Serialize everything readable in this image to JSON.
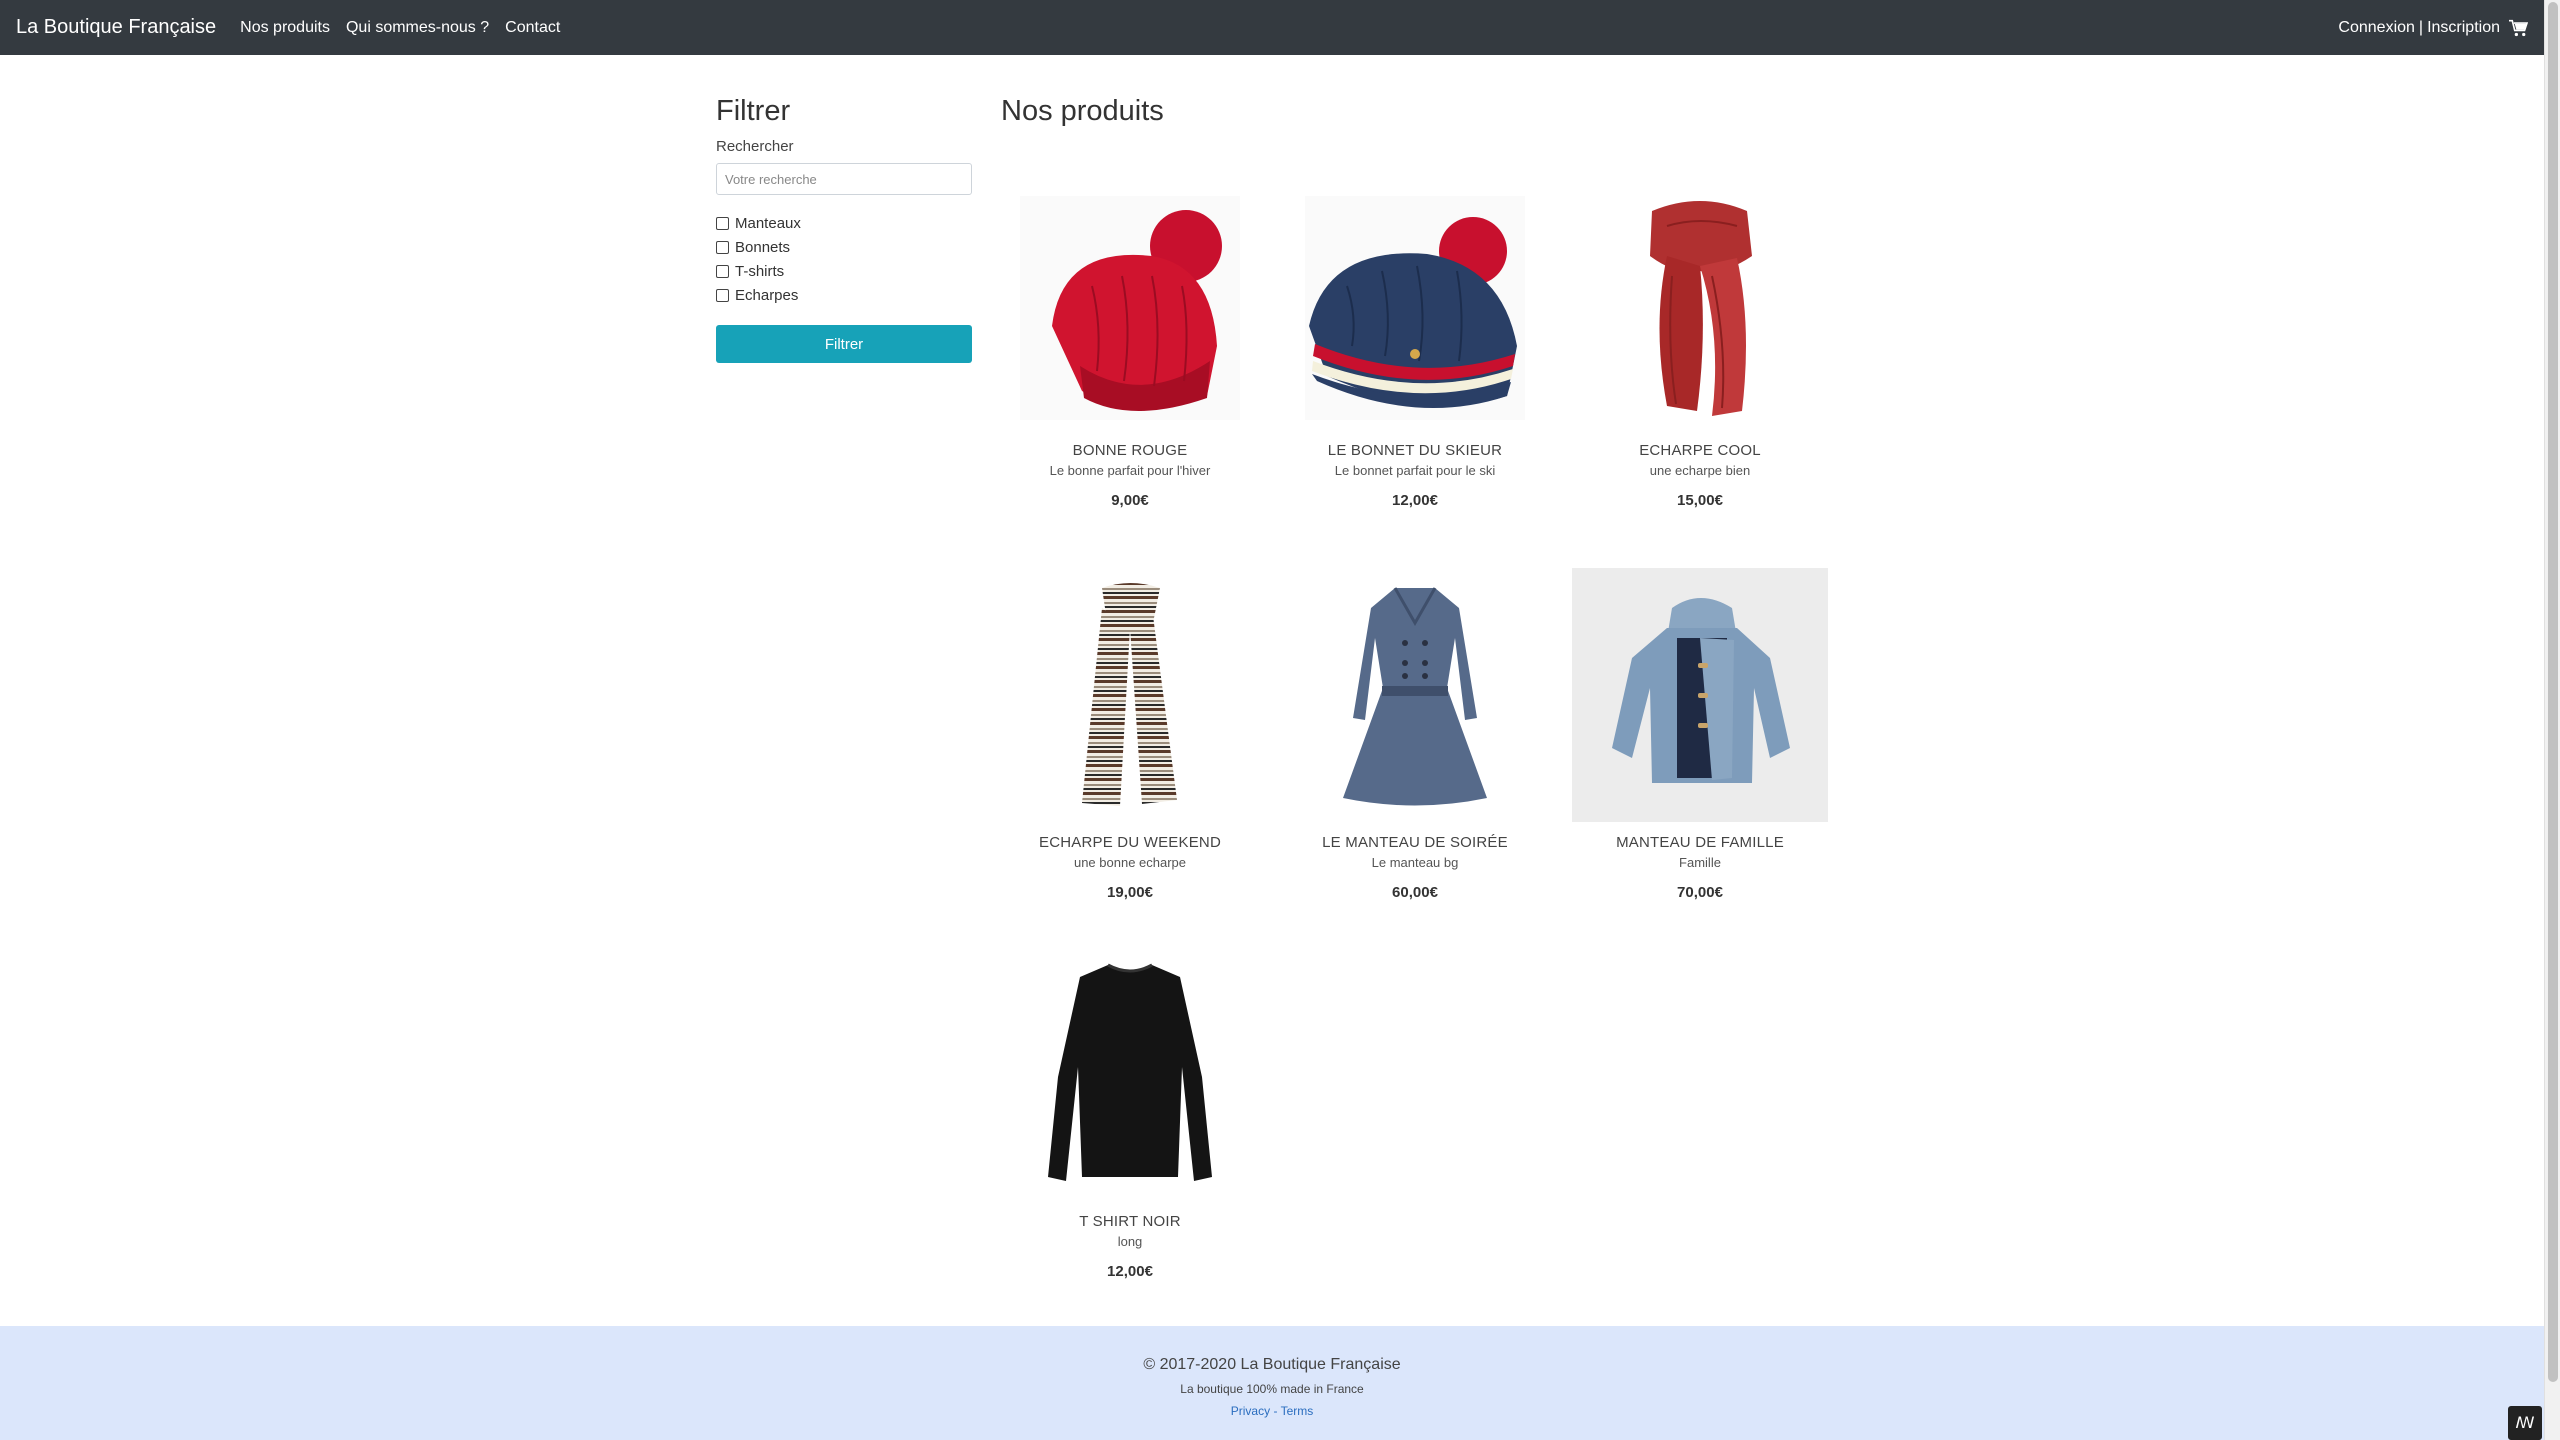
{
  "navbar": {
    "brand": "La Boutique Française",
    "links": [
      "Nos produits",
      "Qui sommes-nous ?",
      "Contact"
    ],
    "login": "Connexion",
    "separator": "|",
    "register": "Inscription",
    "cart_icon": "shopping-cart-icon"
  },
  "filter": {
    "title": "Filtrer",
    "search_label": "Rechercher",
    "search_placeholder": "Votre recherche",
    "categories": [
      "Manteaux",
      "Bonnets",
      "T-shirts",
      "Echarpes"
    ],
    "button_label": "Filtrer",
    "button_color": "#17a2b8"
  },
  "main": {
    "title": "Nos produits",
    "products": [
      {
        "name": "BONNE ROUGE",
        "desc": "Le bonne parfait pour l'hiver",
        "price": "9,00€",
        "icon": "red-beanie-image"
      },
      {
        "name": "LE BONNET DU SKIEUR",
        "desc": "Le bonnet parfait pour le ski",
        "price": "12,00€",
        "icon": "ski-beanie-image"
      },
      {
        "name": "ECHARPE COOL",
        "desc": "une echarpe bien",
        "price": "15,00€",
        "icon": "red-scarf-image"
      },
      {
        "name": "ECHARPE DU WEEKEND",
        "desc": "une bonne echarpe",
        "price": "19,00€",
        "icon": "striped-scarf-image"
      },
      {
        "name": "LE MANTEAU DE SOIRÉE",
        "desc": "Le manteau bg",
        "price": "60,00€",
        "icon": "evening-coat-image"
      },
      {
        "name": "MANTEAU DE FAMILLE",
        "desc": "Famille",
        "price": "70,00€",
        "icon": "duffle-coat-image"
      },
      {
        "name": "T SHIRT NOIR",
        "desc": "long",
        "price": "12,00€",
        "icon": "black-tshirt-image"
      }
    ]
  },
  "footer": {
    "copyright": "© 2017-2020 La Boutique Française",
    "tagline": "La boutique 100% made in France",
    "privacy": "Privacy",
    "dash": "-",
    "terms": "Terms"
  },
  "colors": {
    "navbar_bg": "#343a40",
    "footer_bg": "#dbe6fb",
    "link_blue": "#2a6dbf"
  }
}
